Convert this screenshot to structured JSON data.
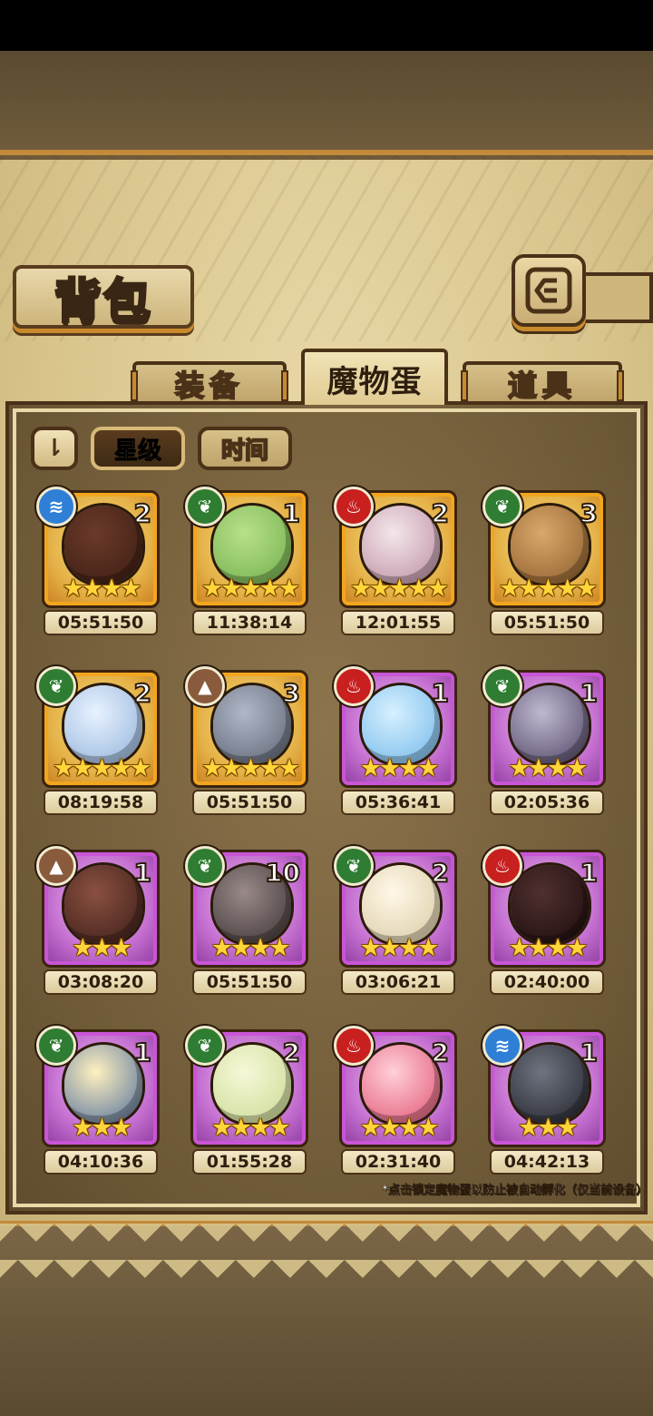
{
  "header": {
    "title": "背包",
    "back_icon": "back-arrow-icon"
  },
  "tabs": [
    {
      "label": "装备",
      "active": false
    },
    {
      "label": "魔物蛋",
      "active": true
    },
    {
      "label": "道具",
      "active": false
    }
  ],
  "sort": {
    "toggle_icon": "sort-order-icon",
    "toggle_glyph": "⇂",
    "options": [
      {
        "label": "星级",
        "active": true
      },
      {
        "label": "时间",
        "active": false
      }
    ]
  },
  "elements": {
    "water": {
      "glyph": "≋",
      "color": "#2f7fd6"
    },
    "wood": {
      "glyph": "❦",
      "color": "#2f7d32"
    },
    "fire": {
      "glyph": "♨",
      "color": "#c81f1f"
    },
    "earth": {
      "glyph": "▲",
      "color": "#8a5a3c"
    }
  },
  "eggs": [
    {
      "element": "water",
      "count": "2",
      "stars": 4,
      "rarity": "gold",
      "timer": "05:51:50",
      "icon": "staff-egg-icon"
    },
    {
      "element": "wood",
      "count": "1",
      "stars": 5,
      "rarity": "gold",
      "timer": "11:38:14",
      "icon": "green-egg-icon"
    },
    {
      "element": "fire",
      "count": "2",
      "stars": 5,
      "rarity": "gold",
      "timer": "12:01:55",
      "icon": "ornate-egg-icon"
    },
    {
      "element": "wood",
      "count": "3",
      "stars": 5,
      "rarity": "gold",
      "timer": "05:51:50",
      "icon": "lyre-egg-icon"
    },
    {
      "element": "wood",
      "count": "2",
      "stars": 5,
      "rarity": "gold",
      "timer": "08:19:58",
      "icon": "pocket-watch-egg-icon"
    },
    {
      "element": "earth",
      "count": "3",
      "stars": 5,
      "rarity": "gold",
      "timer": "05:51:50",
      "icon": "sword-egg-icon"
    },
    {
      "element": "fire",
      "count": "1",
      "stars": 4,
      "rarity": "purple",
      "timer": "05:36:41",
      "icon": "ice-egg-icon"
    },
    {
      "element": "wood",
      "count": "1",
      "stars": 4,
      "rarity": "purple",
      "timer": "02:05:36",
      "icon": "spiked-egg-icon"
    },
    {
      "element": "earth",
      "count": "1",
      "stars": 3,
      "rarity": "purple",
      "timer": "03:08:20",
      "icon": "horn-egg-icon"
    },
    {
      "element": "wood",
      "count": "10",
      "stars": 4,
      "rarity": "purple",
      "timer": "05:51:50",
      "icon": "kunai-egg-icon"
    },
    {
      "element": "wood",
      "count": "2",
      "stars": 4,
      "rarity": "purple",
      "timer": "03:06:21",
      "icon": "winged-egg-icon"
    },
    {
      "element": "fire",
      "count": "1",
      "stars": 4,
      "rarity": "purple",
      "timer": "02:40:00",
      "icon": "crystal-egg-icon"
    },
    {
      "element": "wood",
      "count": "1",
      "stars": 3,
      "rarity": "purple",
      "timer": "04:10:36",
      "icon": "feather-egg-icon"
    },
    {
      "element": "wood",
      "count": "2",
      "stars": 4,
      "rarity": "purple",
      "timer": "01:55:28",
      "icon": "leaf-egg-icon"
    },
    {
      "element": "fire",
      "count": "2",
      "stars": 4,
      "rarity": "purple",
      "timer": "02:31:40",
      "icon": "crown-egg-icon"
    },
    {
      "element": "water",
      "count": "1",
      "stars": 3,
      "rarity": "purple",
      "timer": "04:42:13",
      "icon": "spiked-helmet-egg-icon"
    }
  ],
  "footnote": "*点击锁定魔物蛋以防止被自动孵化（仅当前设备）"
}
